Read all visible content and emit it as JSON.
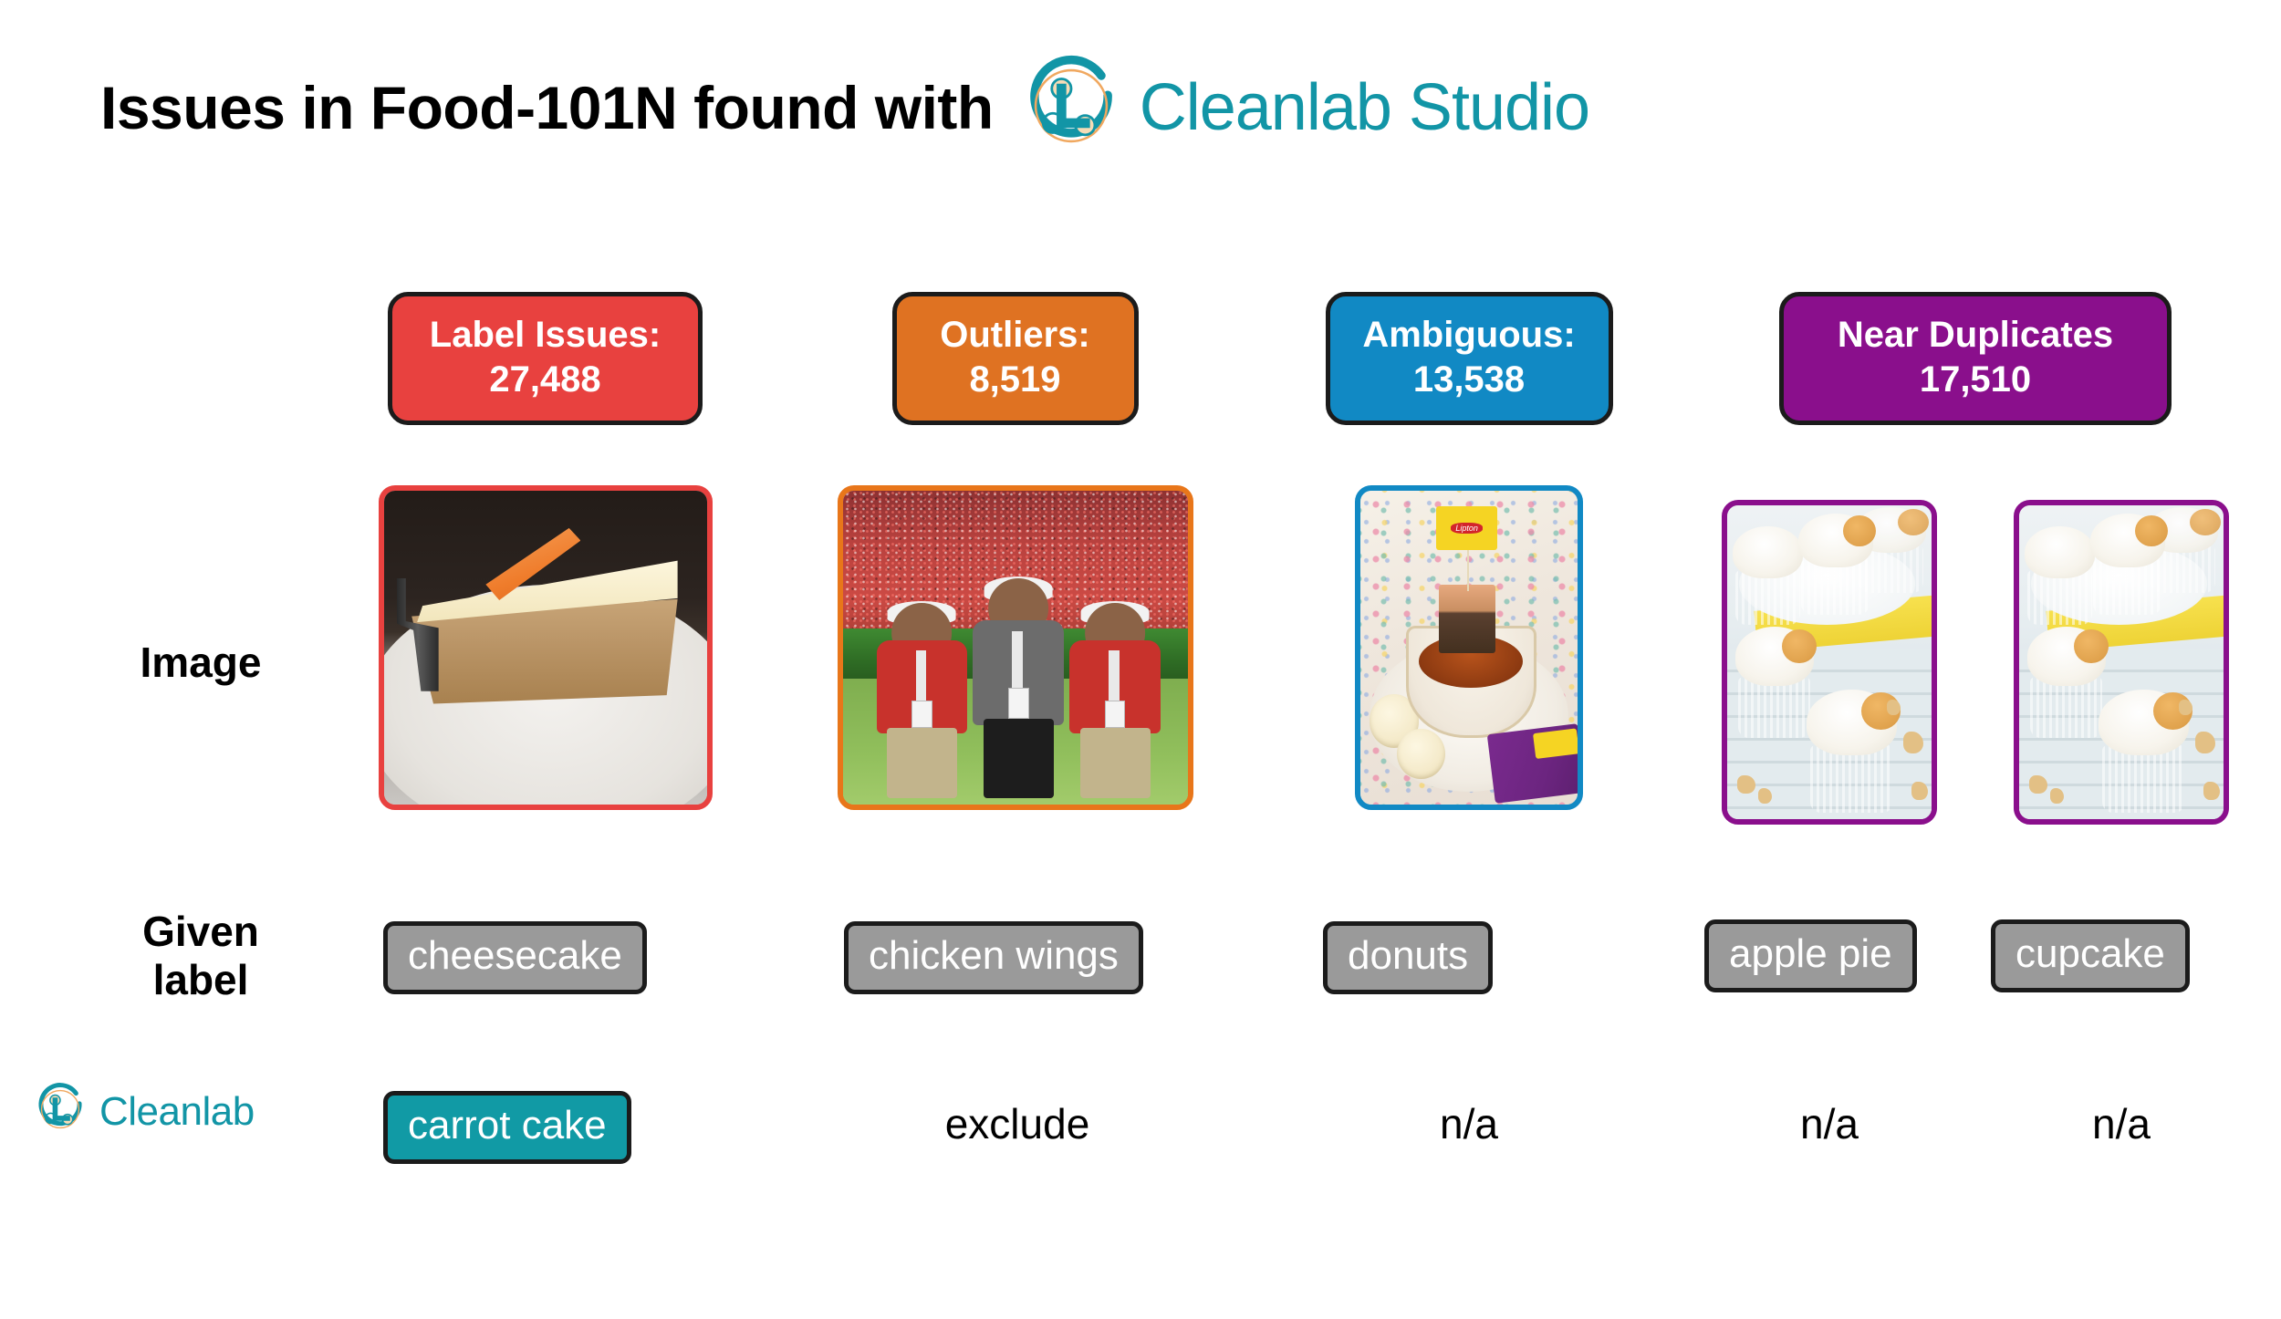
{
  "header": {
    "title": "Issues in Food-101N found with",
    "brand": "Cleanlab Studio",
    "brand_color": "#1295a6",
    "logo_icon": "cleanlab-logo-icon"
  },
  "row_labels": {
    "image": "Image",
    "given_label": "Given\nlabel",
    "given_label_line1": "Given",
    "given_label_line2": "label",
    "cleanlab": "Cleanlab"
  },
  "columns": [
    {
      "id": "label-issues",
      "badge_title": "Label Issues:",
      "badge_count": "27,488",
      "badge_text": "Label Issues:\n27,488",
      "badge_color": "#e8413f",
      "photo_name": "carrot-cake-photo",
      "photo_alt": "slice of carrot cake with cream cheese frosting and a carrot decoration on a white plate with a fork",
      "given_label": "cheesecake",
      "cleanlab_suggestion": "carrot cake",
      "suggestion_style": "chip-teal"
    },
    {
      "id": "outliers",
      "badge_title": "Outliers:",
      "badge_count": "8,519",
      "badge_text": "Outliers:\n8,519",
      "badge_color": "#df7222",
      "photo_name": "stadium-crowd-photo",
      "photo_alt": "three men posing on a football field in front of a red stadium crowd",
      "given_label": "chicken wings",
      "cleanlab_suggestion": "exclude",
      "suggestion_style": "plain"
    },
    {
      "id": "ambiguous",
      "badge_title": "Ambiguous:",
      "badge_count": "13,538",
      "badge_text": "Ambiguous:\n13,538",
      "badge_color": "#1189c4",
      "photo_name": "tea-cup-photo",
      "photo_alt": "floral teacup with a Lipton tea bag being dipped, glazed donuts on the saucer",
      "given_label": "donuts",
      "cleanlab_suggestion": "n/a",
      "suggestion_style": "plain"
    }
  ],
  "near_duplicates": {
    "badge_title": "Near Duplicates",
    "badge_count": "17,510",
    "badge_text": "Near Duplicates\n17,510",
    "badge_color": "#8a0f8c",
    "items": [
      {
        "photo_name": "cupcakes-photo-a",
        "photo_alt": "vanilla cupcakes topped with whipped cream and a wafer cookie on a light wood table",
        "given_label": "apple pie",
        "cleanlab_suggestion": "n/a"
      },
      {
        "photo_name": "cupcakes-photo-b",
        "photo_alt": "vanilla cupcakes topped with whipped cream and a wafer cookie on a light wood table",
        "given_label": "cupcake",
        "cleanlab_suggestion": "n/a"
      }
    ]
  },
  "palette": {
    "red": "#e8413f",
    "orange": "#df7222",
    "blue": "#1189c4",
    "purple": "#8a0f8c",
    "teal": "#119aa5",
    "gray_chip": "#9a9a9a",
    "chip_border": "#1b1b1b",
    "background": "#ffffff"
  }
}
